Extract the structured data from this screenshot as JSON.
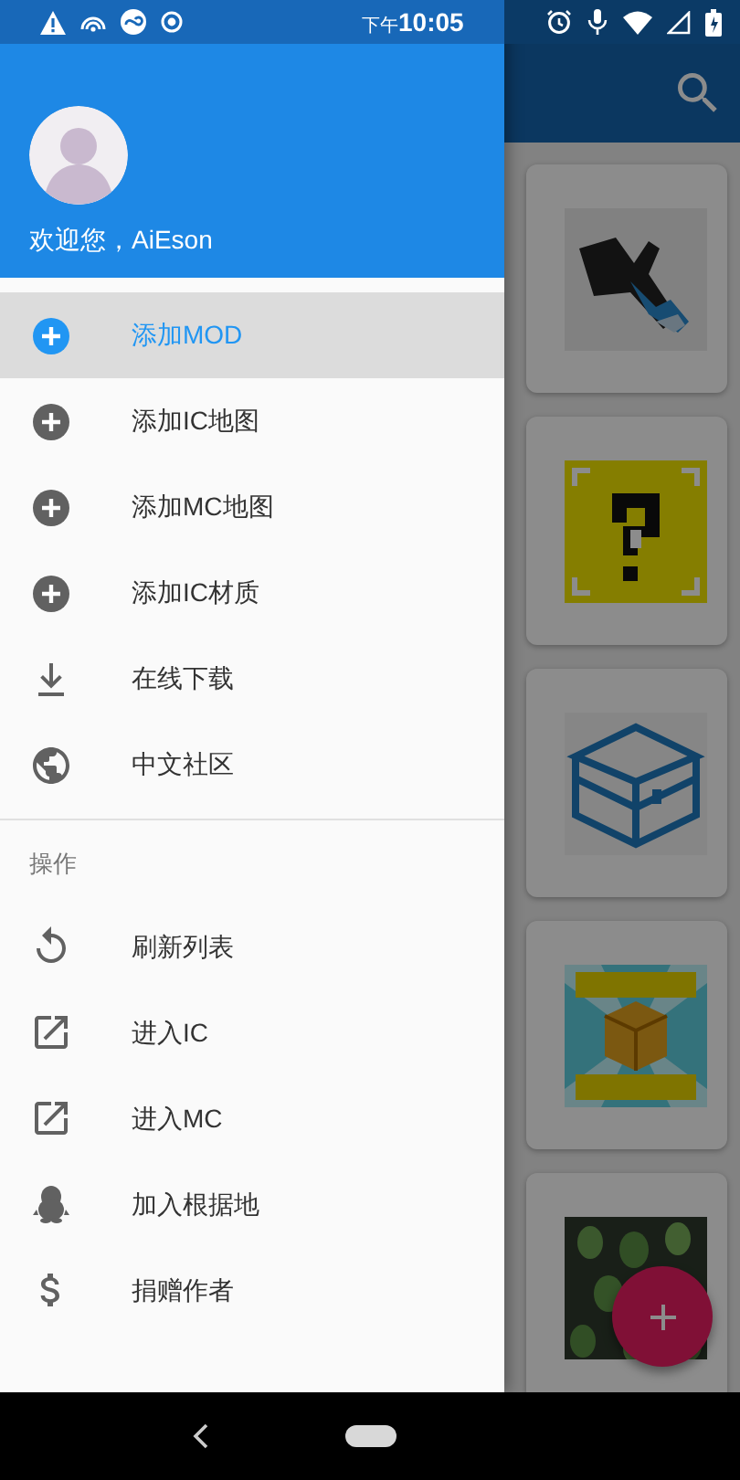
{
  "status_bar": {
    "time_prefix": "下午",
    "time": "10:05"
  },
  "drawer": {
    "welcome": "欢迎您，AiEson",
    "sections": [
      {
        "items": [
          {
            "label": "添加MOD",
            "selected": true
          },
          {
            "label": "添加IC地图",
            "selected": false
          },
          {
            "label": "添加MC地图",
            "selected": false
          },
          {
            "label": "添加IC材质",
            "selected": false
          },
          {
            "label": "在线下载",
            "selected": false
          },
          {
            "label": "中文社区",
            "selected": false
          }
        ]
      },
      {
        "title": "操作",
        "items": [
          {
            "label": "刷新列表",
            "selected": false
          },
          {
            "label": "进入IC",
            "selected": false
          },
          {
            "label": "进入MC",
            "selected": false
          },
          {
            "label": "加入根据地",
            "selected": false
          },
          {
            "label": "捐赠作者",
            "selected": false
          }
        ]
      }
    ]
  }
}
